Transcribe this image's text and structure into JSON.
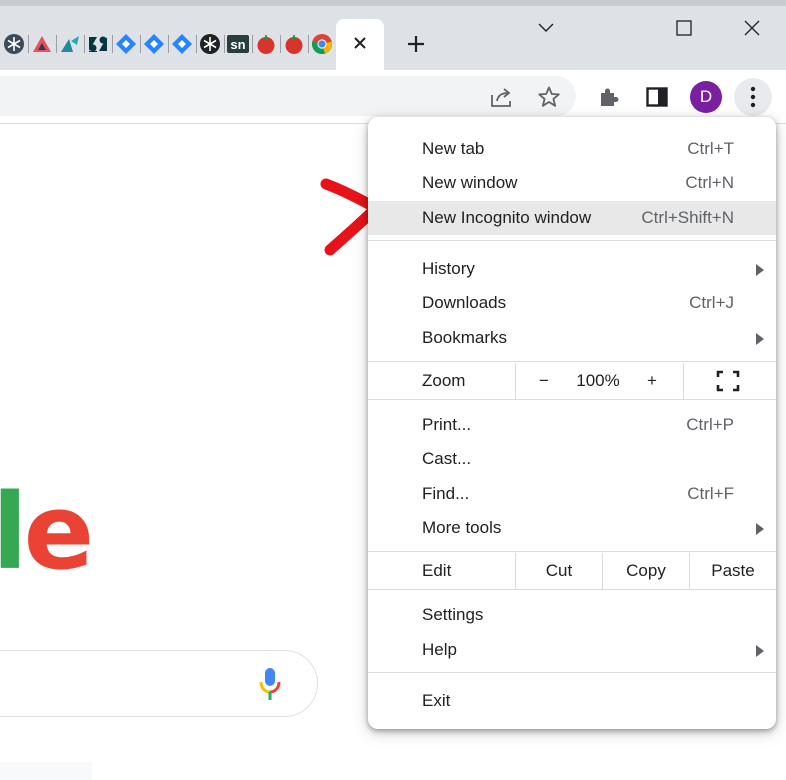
{
  "tabs": {
    "favicons": [
      "snowflake-icon",
      "pink-triangle-icon",
      "teal-triangle-icon",
      "zendesk-icon",
      "jira-icon",
      "jira-icon",
      "jira-icon",
      "snowflake-icon",
      "servicenow-icon",
      "tomato-icon",
      "tomato-icon",
      "chrome-icon"
    ],
    "servicenow_text": "sn",
    "zendesk_text": "Z"
  },
  "toolbar": {
    "avatar_initial": "D"
  },
  "page": {
    "logo_l": "l",
    "logo_e": "e"
  },
  "colors": {
    "avatar": "#7b1fa2",
    "annotation": "#e8121a",
    "highlight": "#e8e8e8",
    "google_green": "#34a853",
    "google_red": "#ea4335"
  },
  "menu": {
    "new_tab": {
      "label": "New tab",
      "shortcut": "Ctrl+T"
    },
    "new_window": {
      "label": "New window",
      "shortcut": "Ctrl+N"
    },
    "new_incognito": {
      "label": "New Incognito window",
      "shortcut": "Ctrl+Shift+N"
    },
    "history": {
      "label": "History"
    },
    "downloads": {
      "label": "Downloads",
      "shortcut": "Ctrl+J"
    },
    "bookmarks": {
      "label": "Bookmarks"
    },
    "zoom": {
      "label": "Zoom",
      "minus": "−",
      "level": "100%",
      "plus": "+"
    },
    "print": {
      "label": "Print...",
      "shortcut": "Ctrl+P"
    },
    "cast": {
      "label": "Cast..."
    },
    "find": {
      "label": "Find...",
      "shortcut": "Ctrl+F"
    },
    "more_tools": {
      "label": "More tools"
    },
    "edit": {
      "label": "Edit",
      "cut": "Cut",
      "copy": "Copy",
      "paste": "Paste"
    },
    "settings": {
      "label": "Settings"
    },
    "help": {
      "label": "Help"
    },
    "exit": {
      "label": "Exit"
    }
  }
}
